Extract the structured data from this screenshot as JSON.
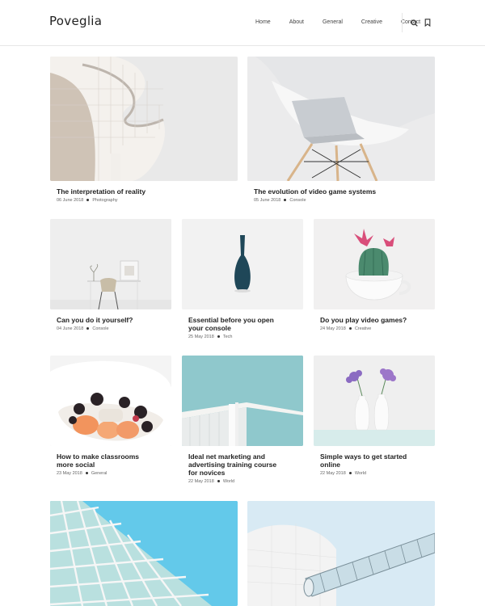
{
  "site": {
    "logo": "Poveglia"
  },
  "nav": {
    "items": [
      "Home",
      "About",
      "General",
      "Creative",
      "Contact"
    ]
  },
  "icons": {
    "search": "search-icon",
    "bookmark": "bookmark-icon"
  },
  "posts": [
    {
      "title": "The interpretation of reality",
      "date": "06 June 2018",
      "category": "Photography"
    },
    {
      "title": "The evolution of video game systems",
      "date": "05 June 2018",
      "category": "Console"
    },
    {
      "title": "Can you do it yourself?",
      "date": "04 June 2018",
      "category": "Console"
    },
    {
      "title_lines": [
        "Essential before you open",
        "your console"
      ],
      "date": "25 May 2018",
      "category": "Tech"
    },
    {
      "title": "Do you play video games?",
      "date": "24 May 2018",
      "category": "Creative"
    },
    {
      "title_lines": [
        "How to make classrooms",
        "more social"
      ],
      "date": "23 May 2018",
      "category": "General"
    },
    {
      "title_lines": [
        "Ideal net marketing and",
        "advertising training course",
        "for novices"
      ],
      "date": "22 May 2018",
      "category": "World"
    },
    {
      "title_lines": [
        "Simple ways to get started",
        "online"
      ],
      "date": "22 May 2018",
      "category": "World"
    }
  ]
}
